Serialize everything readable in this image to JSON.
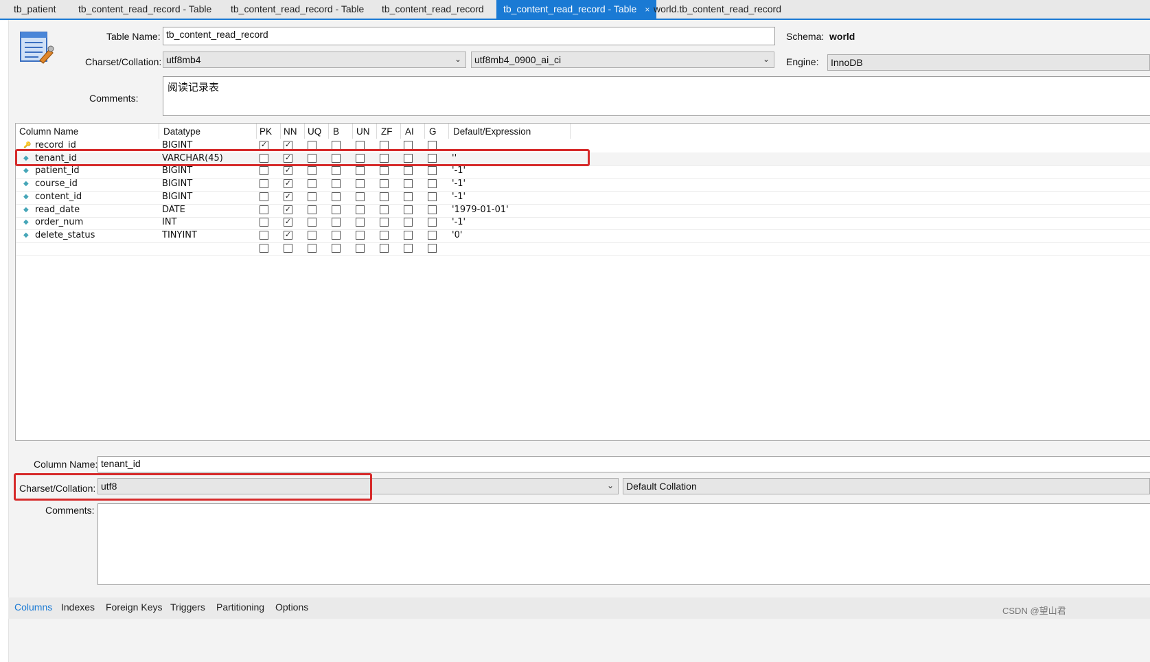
{
  "tabs": [
    {
      "label": "tb_patient",
      "active": false
    },
    {
      "label": "tb_content_read_record - Table",
      "active": false
    },
    {
      "label": "tb_content_read_record - Table",
      "active": false
    },
    {
      "label": "tb_content_read_record",
      "active": false
    },
    {
      "label": "tb_content_read_record - Table",
      "active": true,
      "close": "×"
    },
    {
      "label": "world.tb_content_read_record",
      "active": false
    }
  ],
  "table": {
    "name_label": "Table Name:",
    "name": "tb_content_read_record",
    "schema_label": "Schema:",
    "schema": "world",
    "charset_label": "Charset/Collation:",
    "charset": "utf8mb4",
    "collation": "utf8mb4_0900_ai_ci",
    "engine_label": "Engine:",
    "engine": "InnoDB",
    "comments_label": "Comments:",
    "comments": "阅读记录表"
  },
  "grid": {
    "headers": [
      "Column Name",
      "Datatype",
      "PK",
      "NN",
      "UQ",
      "B",
      "UN",
      "ZF",
      "AI",
      "G",
      "Default/Expression"
    ],
    "rows": [
      {
        "name": "record_id",
        "type": "BIGINT",
        "flags": [
          1,
          1,
          0,
          0,
          0,
          0,
          0,
          0
        ],
        "default": "",
        "icon": "key-icon"
      },
      {
        "name": "tenant_id",
        "type": "VARCHAR(45)",
        "flags": [
          0,
          1,
          0,
          0,
          0,
          0,
          0,
          0
        ],
        "default": "''",
        "icon": "diamond-icon",
        "selected": true
      },
      {
        "name": "patient_id",
        "type": "BIGINT",
        "flags": [
          0,
          1,
          0,
          0,
          0,
          0,
          0,
          0
        ],
        "default": "'-1'",
        "icon": "diamond-icon"
      },
      {
        "name": "course_id",
        "type": "BIGINT",
        "flags": [
          0,
          1,
          0,
          0,
          0,
          0,
          0,
          0
        ],
        "default": "'-1'",
        "icon": "diamond-icon"
      },
      {
        "name": "content_id",
        "type": "BIGINT",
        "flags": [
          0,
          1,
          0,
          0,
          0,
          0,
          0,
          0
        ],
        "default": "'-1'",
        "icon": "diamond-icon"
      },
      {
        "name": "read_date",
        "type": "DATE",
        "flags": [
          0,
          1,
          0,
          0,
          0,
          0,
          0,
          0
        ],
        "default": "'1979-01-01'",
        "icon": "diamond-icon"
      },
      {
        "name": "order_num",
        "type": "INT",
        "flags": [
          0,
          1,
          0,
          0,
          0,
          0,
          0,
          0
        ],
        "default": "'-1'",
        "icon": "diamond-icon"
      },
      {
        "name": "delete_status",
        "type": "TINYINT",
        "flags": [
          0,
          1,
          0,
          0,
          0,
          0,
          0,
          0
        ],
        "default": "'0'",
        "icon": "diamond-icon"
      },
      {
        "name": "",
        "type": "",
        "flags": [
          0,
          0,
          0,
          0,
          0,
          0,
          0,
          0
        ],
        "default": "",
        "icon": ""
      }
    ]
  },
  "column": {
    "name_label": "Column Name:",
    "name": "tenant_id",
    "charset_label": "Charset/Collation:",
    "charset": "utf8",
    "collation": "Default Collation",
    "comments_label": "Comments:",
    "comments": ""
  },
  "bottom_tabs": [
    {
      "label": "Columns",
      "active": true
    },
    {
      "label": "Indexes",
      "active": false
    },
    {
      "label": "Foreign Keys",
      "active": false
    },
    {
      "label": "Triggers",
      "active": false
    },
    {
      "label": "Partitioning",
      "active": false
    },
    {
      "label": "Options",
      "active": false
    }
  ],
  "watermark": "CSDN @望山君",
  "colors": {
    "accent": "#1a7ad4",
    "highlight": "#d62a2a"
  }
}
